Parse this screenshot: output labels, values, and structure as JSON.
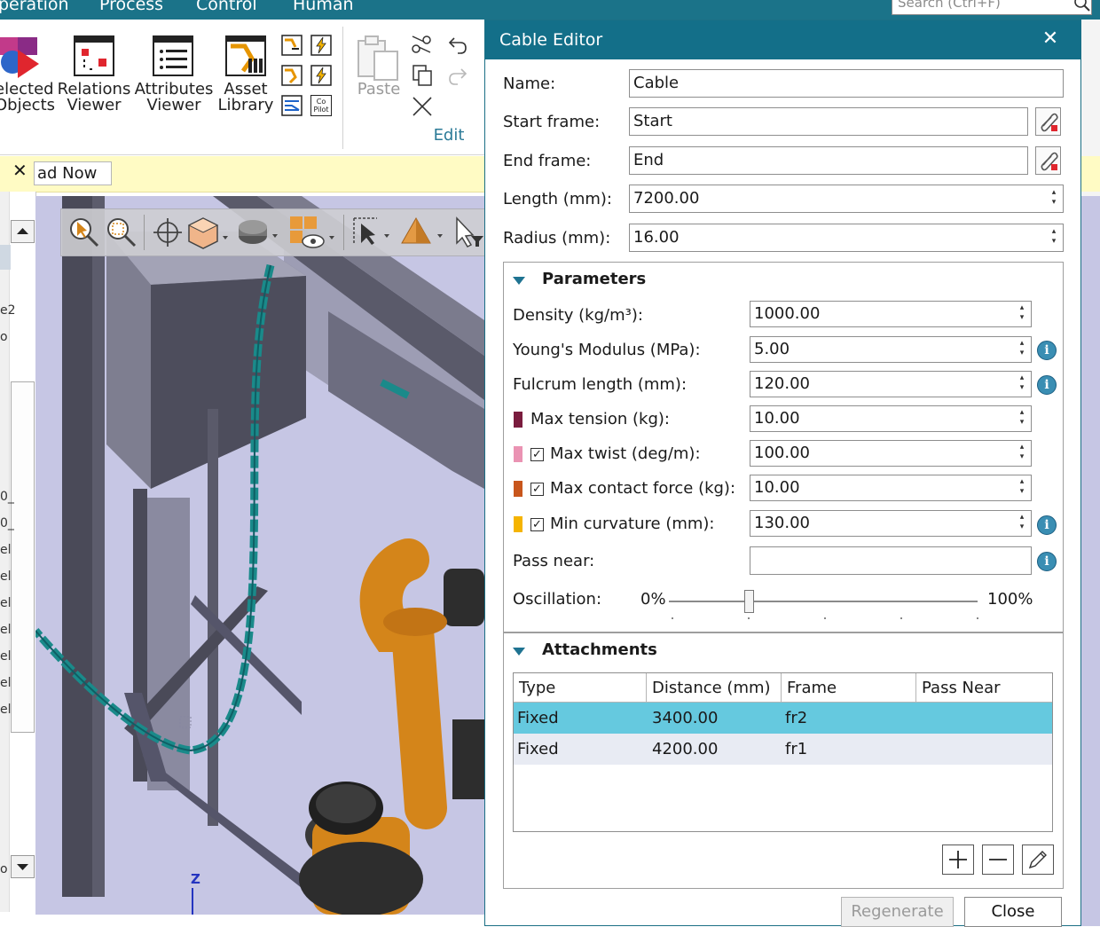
{
  "menubar": {
    "items": [
      "peration",
      "Process",
      "Control",
      "Human"
    ],
    "search_placeholder": "Search (Ctrl+F)"
  },
  "ribbon": {
    "selected_objects": [
      "elected",
      "Objects"
    ],
    "relations_viewer": [
      "Relations",
      "Viewer"
    ],
    "attributes_viewer": [
      "Attributes",
      "Viewer"
    ],
    "asset_library": [
      "Asset",
      "Library"
    ],
    "copilot_icon_text": [
      "Co",
      "Pilot"
    ],
    "paste_label": "Paste",
    "edit_group_label": "Edit"
  },
  "infobar": {
    "close_glyph": "✕",
    "read_now_label": "ad Now"
  },
  "left_panel": {
    "fragments": [
      "e2",
      "o",
      "0_",
      "0_",
      "el",
      "el",
      "el",
      "el",
      "el",
      "el",
      "el",
      "o"
    ]
  },
  "viewport": {
    "axis_label": "Z",
    "colors": {
      "background": "#c6c6e4",
      "cable": "#1a8a8a",
      "robot": "#d4851a"
    }
  },
  "dialog": {
    "title": "Cable Editor",
    "close_glyph": "✕",
    "name_label": "Name:",
    "name_value": "Cable",
    "start_label": "Start frame:",
    "start_value": "Start",
    "end_label": "End frame:",
    "end_value": "End",
    "length_label": "Length (mm):",
    "length_value": "7200.00",
    "radius_label": "Radius (mm):",
    "radius_value": "16.00",
    "spin_glyphs": [
      "▴",
      "▾"
    ],
    "parameters": {
      "title": "Parameters",
      "density_label": "Density (kg/m³):",
      "density_value": "1000.00",
      "youngs_label": "Young's Modulus (MPa):",
      "youngs_value": "5.00",
      "fulcrum_label": "Fulcrum length (mm):",
      "fulcrum_value": "120.00",
      "max_tension_label": "Max tension (kg):",
      "max_tension_value": "10.00",
      "max_twist_label": "Max twist (deg/m):",
      "max_twist_value": "100.00",
      "max_contact_label": "Max contact force (kg):",
      "max_contact_value": "10.00",
      "min_curvature_label": "Min curvature (mm):",
      "min_curvature_value": "130.00",
      "pass_near_label": "Pass near:",
      "pass_near_value": "",
      "oscillation_label": "Oscillation:",
      "oscillation_min": "0%",
      "oscillation_max": "100%",
      "oscillation_value": 0.26,
      "info_glyph": "i",
      "check_glyph": "✓",
      "swatch_colors": {
        "max_tension": "#7a1c3e",
        "max_twist": "#ea93b3",
        "max_contact": "#c8561c",
        "min_curvature": "#f5b400"
      }
    },
    "attachments": {
      "title": "Attachments",
      "columns": [
        "Type",
        "Distance (mm)",
        "Frame",
        "Pass Near"
      ],
      "rows": [
        {
          "type": "Fixed",
          "distance": "3400.00",
          "frame": "fr2",
          "pass_near": ""
        },
        {
          "type": "Fixed",
          "distance": "4200.00",
          "frame": "fr1",
          "pass_near": ""
        }
      ],
      "selected_row_color": "#65c9df",
      "alt_row_color": "#e8ebf3"
    },
    "buttons": {
      "regenerate": "Regenerate",
      "close": "Close"
    }
  }
}
